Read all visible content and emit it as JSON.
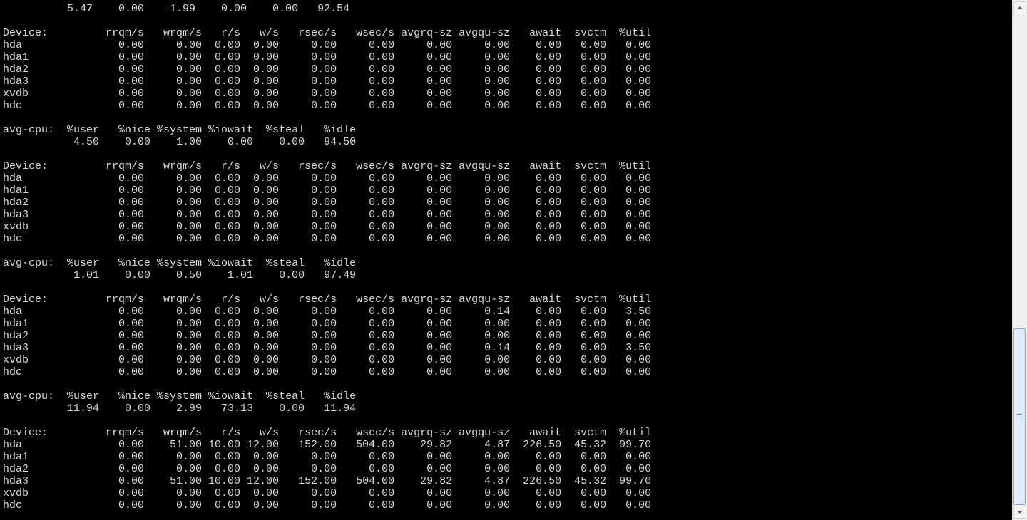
{
  "terminal": {
    "lines": [
      "          5.47    0.00    1.99    0.00    0.00   92.54",
      "",
      "Device:         rrqm/s   wrqm/s   r/s   w/s   rsec/s   wsec/s avgrq-sz avgqu-sz   await  svctm  %util",
      "hda               0.00     0.00  0.00  0.00     0.00     0.00     0.00     0.00    0.00   0.00   0.00",
      "hda1              0.00     0.00  0.00  0.00     0.00     0.00     0.00     0.00    0.00   0.00   0.00",
      "hda2              0.00     0.00  0.00  0.00     0.00     0.00     0.00     0.00    0.00   0.00   0.00",
      "hda3              0.00     0.00  0.00  0.00     0.00     0.00     0.00     0.00    0.00   0.00   0.00",
      "xvdb              0.00     0.00  0.00  0.00     0.00     0.00     0.00     0.00    0.00   0.00   0.00",
      "hdc               0.00     0.00  0.00  0.00     0.00     0.00     0.00     0.00    0.00   0.00   0.00",
      "",
      "avg-cpu:  %user   %nice %system %iowait  %steal   %idle",
      "           4.50    0.00    1.00    0.00    0.00   94.50",
      "",
      "Device:         rrqm/s   wrqm/s   r/s   w/s   rsec/s   wsec/s avgrq-sz avgqu-sz   await  svctm  %util",
      "hda               0.00     0.00  0.00  0.00     0.00     0.00     0.00     0.00    0.00   0.00   0.00",
      "hda1              0.00     0.00  0.00  0.00     0.00     0.00     0.00     0.00    0.00   0.00   0.00",
      "hda2              0.00     0.00  0.00  0.00     0.00     0.00     0.00     0.00    0.00   0.00   0.00",
      "hda3              0.00     0.00  0.00  0.00     0.00     0.00     0.00     0.00    0.00   0.00   0.00",
      "xvdb              0.00     0.00  0.00  0.00     0.00     0.00     0.00     0.00    0.00   0.00   0.00",
      "hdc               0.00     0.00  0.00  0.00     0.00     0.00     0.00     0.00    0.00   0.00   0.00",
      "",
      "avg-cpu:  %user   %nice %system %iowait  %steal   %idle",
      "           1.01    0.00    0.50    1.01    0.00   97.49",
      "",
      "Device:         rrqm/s   wrqm/s   r/s   w/s   rsec/s   wsec/s avgrq-sz avgqu-sz   await  svctm  %util",
      "hda               0.00     0.00  0.00  0.00     0.00     0.00     0.00     0.14    0.00   0.00   3.50",
      "hda1              0.00     0.00  0.00  0.00     0.00     0.00     0.00     0.00    0.00   0.00   0.00",
      "hda2              0.00     0.00  0.00  0.00     0.00     0.00     0.00     0.00    0.00   0.00   0.00",
      "hda3              0.00     0.00  0.00  0.00     0.00     0.00     0.00     0.14    0.00   0.00   3.50",
      "xvdb              0.00     0.00  0.00  0.00     0.00     0.00     0.00     0.00    0.00   0.00   0.00",
      "hdc               0.00     0.00  0.00  0.00     0.00     0.00     0.00     0.00    0.00   0.00   0.00",
      "",
      "avg-cpu:  %user   %nice %system %iowait  %steal   %idle",
      "          11.94    0.00    2.99   73.13    0.00   11.94",
      "",
      "Device:         rrqm/s   wrqm/s   r/s   w/s   rsec/s   wsec/s avgrq-sz avgqu-sz   await  svctm  %util",
      "hda               0.00    51.00 10.00 12.00   152.00   504.00    29.82     4.87  226.50  45.32  99.70",
      "hda1              0.00     0.00  0.00  0.00     0.00     0.00     0.00     0.00    0.00   0.00   0.00",
      "hda2              0.00     0.00  0.00  0.00     0.00     0.00     0.00     0.00    0.00   0.00   0.00",
      "hda3              0.00    51.00 10.00 12.00   152.00   504.00    29.82     4.87  226.50  45.32  99.70",
      "xvdb              0.00     0.00  0.00  0.00     0.00     0.00     0.00     0.00    0.00   0.00   0.00",
      "hdc               0.00     0.00  0.00  0.00     0.00     0.00     0.00     0.00    0.00   0.00   0.00"
    ]
  },
  "colors": {
    "terminal_bg": "#000000",
    "terminal_fg": "#d8d8d8",
    "scrollbar_track": "#f0f0f0",
    "scrollbar_thumb": "#d6e6f7"
  },
  "icons": {
    "scroll_up": "scroll-up-arrow-icon",
    "scroll_down": "scroll-down-arrow-icon",
    "thumb_grip": "scrollbar-grip-icon"
  }
}
